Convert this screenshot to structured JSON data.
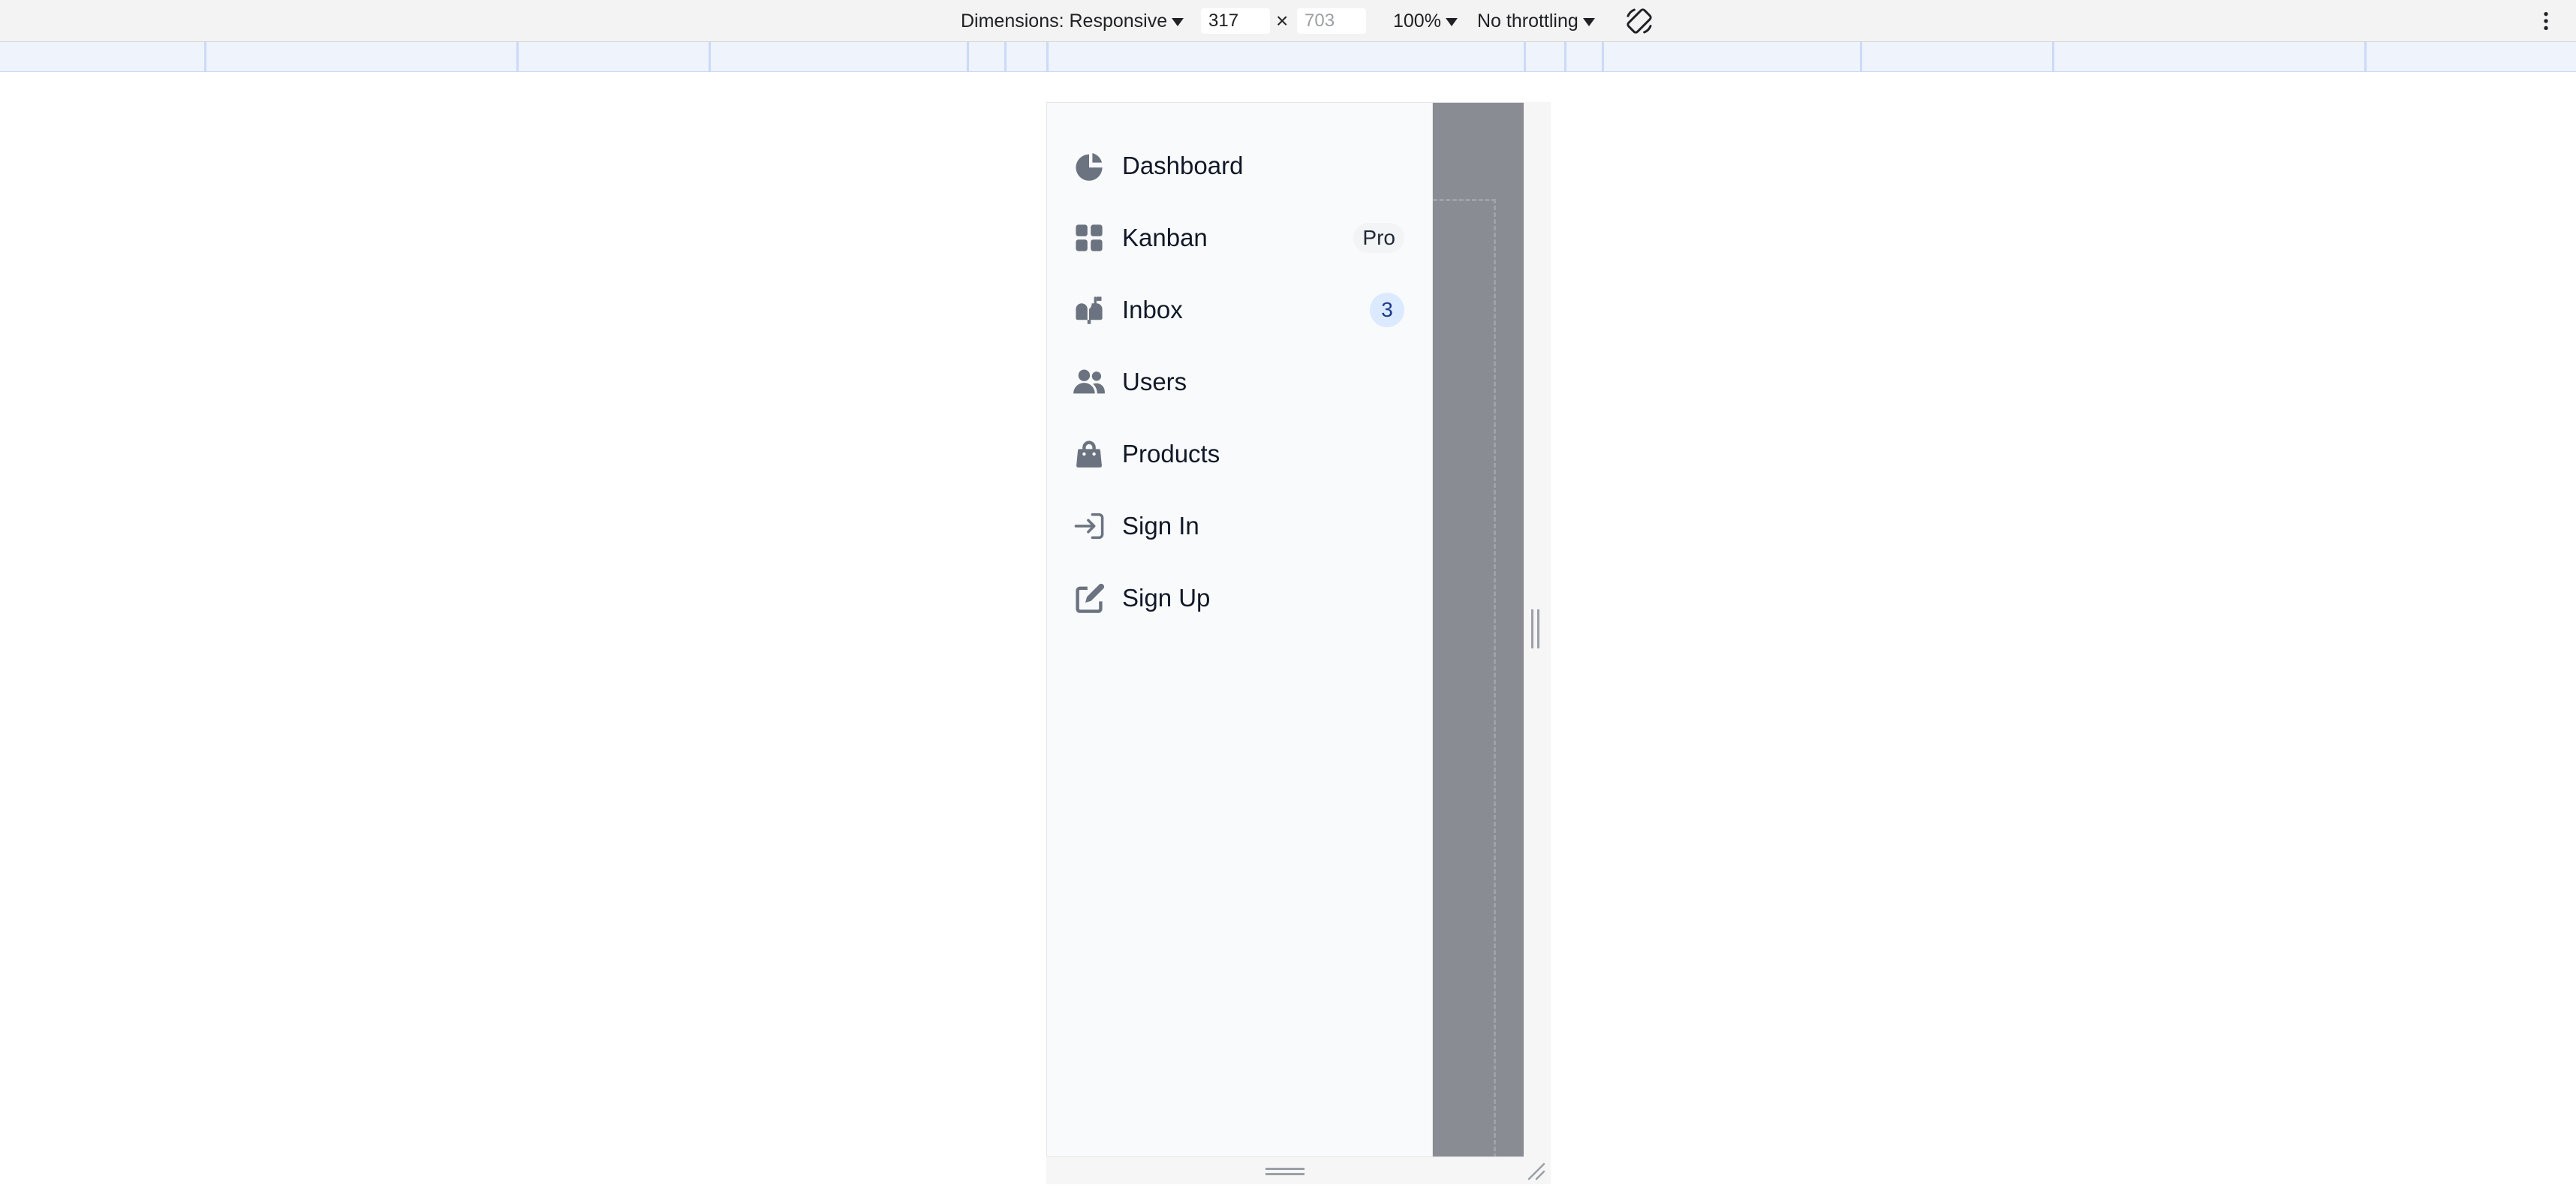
{
  "devtools": {
    "dimensions_label": "Dimensions: Responsive",
    "width_value": "317",
    "times_symbol": "×",
    "height_placeholder": "703",
    "zoom": "100%",
    "throttling": "No throttling"
  },
  "sidebar": {
    "items": [
      {
        "label": "Dashboard",
        "icon": "chart-pie-icon"
      },
      {
        "label": "Kanban",
        "icon": "view-grid-icon",
        "badge": "Pro"
      },
      {
        "label": "Inbox",
        "icon": "inbox-icon",
        "badge": "3"
      },
      {
        "label": "Users",
        "icon": "users-icon"
      },
      {
        "label": "Products",
        "icon": "shopping-bag-icon"
      },
      {
        "label": "Sign In",
        "icon": "login-icon"
      },
      {
        "label": "Sign Up",
        "icon": "pencil-square-icon"
      }
    ]
  },
  "colors": {
    "icon": "#6b7280",
    "text": "#111827",
    "sidebar_bg": "#f9fafb",
    "overlay": "#8a8c93",
    "badge_count_bg": "#dbeafe",
    "badge_count_text": "#1e3a8a"
  }
}
